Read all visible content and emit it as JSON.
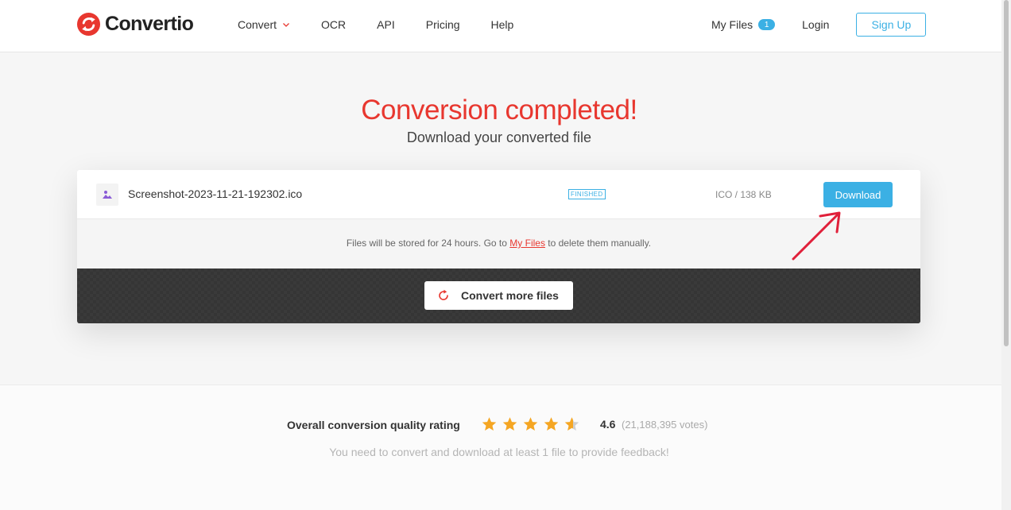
{
  "brand": {
    "name": "Convertio",
    "color": "#e8372f"
  },
  "nav": {
    "items": [
      {
        "label": "Convert",
        "has_dropdown": true
      },
      {
        "label": "OCR"
      },
      {
        "label": "API"
      },
      {
        "label": "Pricing"
      },
      {
        "label": "Help"
      }
    ],
    "my_files_label": "My Files",
    "my_files_count": "1",
    "login_label": "Login",
    "signup_label": "Sign Up"
  },
  "hero": {
    "title": "Conversion completed!",
    "subtitle": "Download your converted file"
  },
  "file": {
    "name": "Screenshot-2023-11-21-192302.ico",
    "icon": "image-file-icon",
    "status": "FINISHED",
    "meta": "ICO / 138 KB",
    "download_label": "Download"
  },
  "storage_note": {
    "prefix": "Files will be stored for 24 hours. Go to ",
    "link": "My Files",
    "suffix": " to delete them manually."
  },
  "convert_more_label": "Convert more files",
  "rating": {
    "label": "Overall conversion quality rating",
    "stars_filled": 4.6,
    "stars_total": 5,
    "score": "4.6",
    "votes": "(21,188,395 votes)",
    "note": "You need to convert and download at least 1 file to provide feedback!"
  },
  "colors": {
    "accent": "#3bb0e4",
    "brand_red": "#e8372f",
    "star": "#f5a623"
  }
}
